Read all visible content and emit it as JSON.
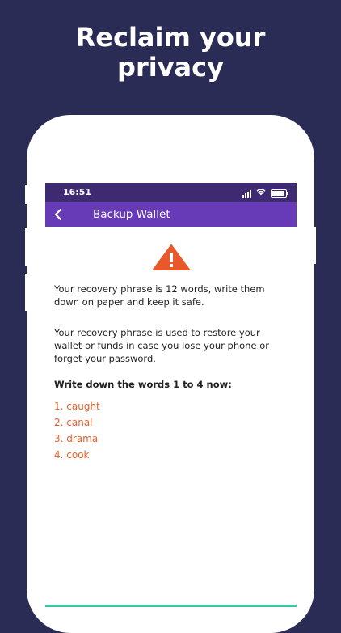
{
  "headline": {
    "line1": "Reclaim your",
    "line2": "privacy"
  },
  "status_bar": {
    "time": "16:51",
    "signal_icon": "signal-icon",
    "wifi_icon": "wifi-icon",
    "battery_icon": "battery-icon"
  },
  "app_bar": {
    "title": "Backup Wallet",
    "back_icon": "chevron-left-icon"
  },
  "content": {
    "warning_icon": "warning-triangle-icon",
    "paragraph1": "Your recovery phrase is 12 words, write them down on paper and keep it safe.",
    "paragraph2": "Your recovery phrase is used to restore your wallet or funds in case you lose your phone or forget your password.",
    "instruction": "Write down the words 1 to 4 now:",
    "words": [
      "1. caught",
      "2. canal",
      "3. drama",
      "4. cook"
    ]
  },
  "colors": {
    "background": "#2b2c55",
    "status_bar": "#3d2a73",
    "app_bar": "#673ab7",
    "warning": "#e8582a",
    "word": "#e8602a",
    "bottom_accent": "#3cc4a4"
  }
}
